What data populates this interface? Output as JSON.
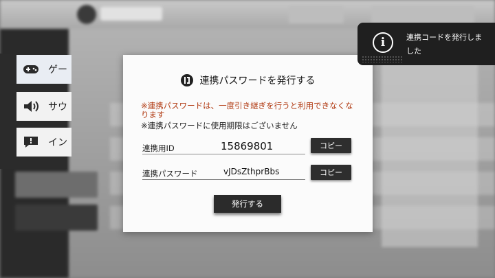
{
  "menu": {
    "items": [
      {
        "label": "ゲー",
        "icon": "gamepad-icon"
      },
      {
        "label": "サウ",
        "icon": "speaker-icon"
      },
      {
        "label": "イン",
        "icon": "speech-bubble-icon"
      }
    ]
  },
  "dialog": {
    "title": "連携パスワードを発行する",
    "warning": "※連携パスワードは、一度引き継ぎを行うと利用できなくなります",
    "note": "※連携パスワードに使用期限はございません",
    "id_label": "連携用ID",
    "id_value": "15869801",
    "password_label": "連携パスワード",
    "password_value": "vJDsZthprBbs",
    "copy_label": "コピー",
    "issue_label": "発行する"
  },
  "toast": {
    "text": "連携コードを発行しました",
    "icon": "info-icon"
  },
  "colors": {
    "warning_text": "#b13a12",
    "button_dark": "#2b2b2b",
    "toast_bg": "#1f1f1f"
  }
}
